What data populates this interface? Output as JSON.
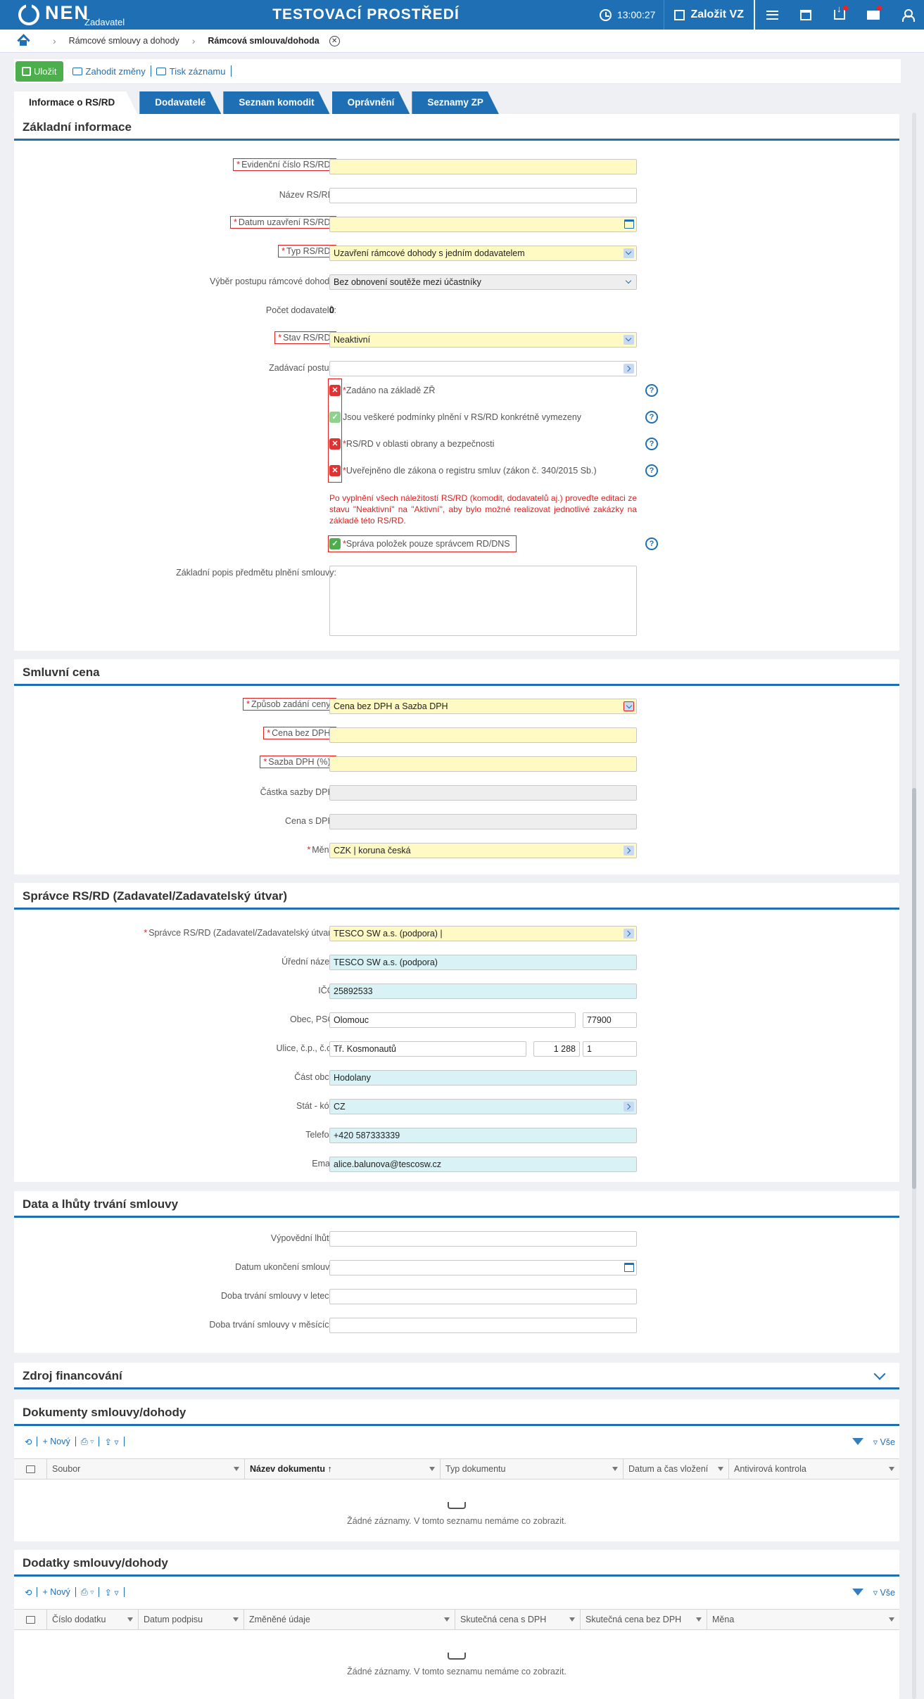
{
  "header": {
    "logo": "NEN",
    "logo_sub": "Zadavatel",
    "env_title": "TESTOVACÍ PROSTŘEDÍ",
    "time": "13:00:27",
    "create_label": "Založit VZ"
  },
  "breadcrumb": {
    "items": [
      "Rámcové smlouvy a dohody",
      "Rámcová smlouva/dohoda"
    ]
  },
  "toolbar": {
    "save": "Uložit",
    "discard": "Zahodit změny",
    "print": "Tisk záznamu"
  },
  "tabs": [
    "Informace o RS/RD",
    "Dodavatelé",
    "Seznam komodit",
    "Oprávnění",
    "Seznamy ZP"
  ],
  "basic": {
    "title": "Základní informace",
    "fields": [
      {
        "label": "Evidenční číslo RS/RD",
        "value": ""
      },
      {
        "label": "Název RS/RD",
        "value": ""
      },
      {
        "label": "Datum uzavření RS/RD",
        "value": ""
      },
      {
        "label": "Typ RS/RD",
        "value": "Uzavření rámcové dohody s jedním dodavatelem"
      },
      {
        "label": "Výběr postupu rámcové dohody",
        "value": "Bez obnovení soutěže mezi účastníky"
      },
      {
        "label": "Počet dodavatelů",
        "value": "0"
      },
      {
        "label": "Stav RS/RD",
        "value": "Neaktivní"
      },
      {
        "label": "Zadávací postup",
        "value": ""
      }
    ],
    "checks": [
      "Zadáno na základě ZŘ",
      "Jsou veškeré podmínky plnění v RS/RD konkrétně vymezeny",
      "RS/RD v oblasti obrany a bezpečnosti",
      "Uveřejněno dle zákona o registru smluv (zákon č. 340/2015 Sb.)"
    ],
    "warning": "Po vyplnění všech náležitostí RS/RD (komodit, dodavatelů aj.) proveďte editaci ze stavu \"Neaktivní\" na \"Aktivní\", aby bylo možné realizovat jednotlivé zakázky na základě této RS/RD.",
    "check_admin": "Správa položek pouze správcem RD/DNS",
    "desc_label": "Základní popis předmětu plnění smlouvy"
  },
  "price": {
    "title": "Smluvní cena",
    "fields": [
      {
        "label": "Způsob zadání ceny",
        "value": "Cena bez DPH a Sazba DPH"
      },
      {
        "label": "Cena bez DPH",
        "value": ""
      },
      {
        "label": "Sazba DPH (%)",
        "value": ""
      },
      {
        "label": "Částka sazby DPH",
        "value": ""
      },
      {
        "label": "Cena s DPH",
        "value": ""
      },
      {
        "label": "Měna",
        "value": "CZK | koruna česká"
      }
    ]
  },
  "admin": {
    "title": "Správce RS/RD (Zadavatel/Zadavatelský útvar)",
    "fields": [
      {
        "label": "Správce RS/RD (Zadavatel/Zadavatelský útvar)",
        "value": "TESCO SW a.s. (podpora) |"
      },
      {
        "label": "Úřední název",
        "value": "TESCO SW a.s. (podpora)"
      },
      {
        "label": "IČO",
        "value": "25892533"
      },
      {
        "label": "Obec, PSČ",
        "value": "Olomouc",
        "value2": "77900"
      },
      {
        "label": "Ulice, č.p., č.o.",
        "value": "Tř. Kosmonautů",
        "value2": "1 288",
        "value3": "1"
      },
      {
        "label": "Část obce",
        "value": "Hodolany"
      },
      {
        "label": "Stát - kód",
        "value": "CZ"
      },
      {
        "label": "Telefon",
        "value": "+420 587333339"
      },
      {
        "label": "Email",
        "value": "alice.balunova@tescosw.cz"
      }
    ]
  },
  "terms": {
    "title": "Data a lhůty trvání smlouvy",
    "fields": [
      {
        "label": "Výpovědní lhůta",
        "value": ""
      },
      {
        "label": "Datum ukončení smlouvy",
        "value": ""
      },
      {
        "label": "Doba trvání smlouvy v letech",
        "value": ""
      },
      {
        "label": "Doba trvání smlouvy v měsících",
        "value": ""
      }
    ]
  },
  "funding": {
    "title": "Zdroj financování"
  },
  "docs": {
    "title": "Dokumenty smlouvy/dohody",
    "new": "Nový",
    "all": "Vše",
    "columns": [
      "Soubor",
      "Název dokumentu",
      "Typ dokumentu",
      "Datum a čas vložení",
      "Antivirová kontrola"
    ],
    "empty": "Žádné záznamy. V tomto seznamu nemáme co zobrazit."
  },
  "amend": {
    "title": "Dodatky smlouvy/dohody",
    "new": "Nový",
    "all": "Vše",
    "columns": [
      "Číslo dodatku",
      "Datum podpisu",
      "Změněné údaje",
      "Skutečná cena s DPH",
      "Skutečná cena bez DPH",
      "Měna"
    ],
    "empty": "Žádné záznamy. V tomto seznamu nemáme co zobrazit."
  }
}
